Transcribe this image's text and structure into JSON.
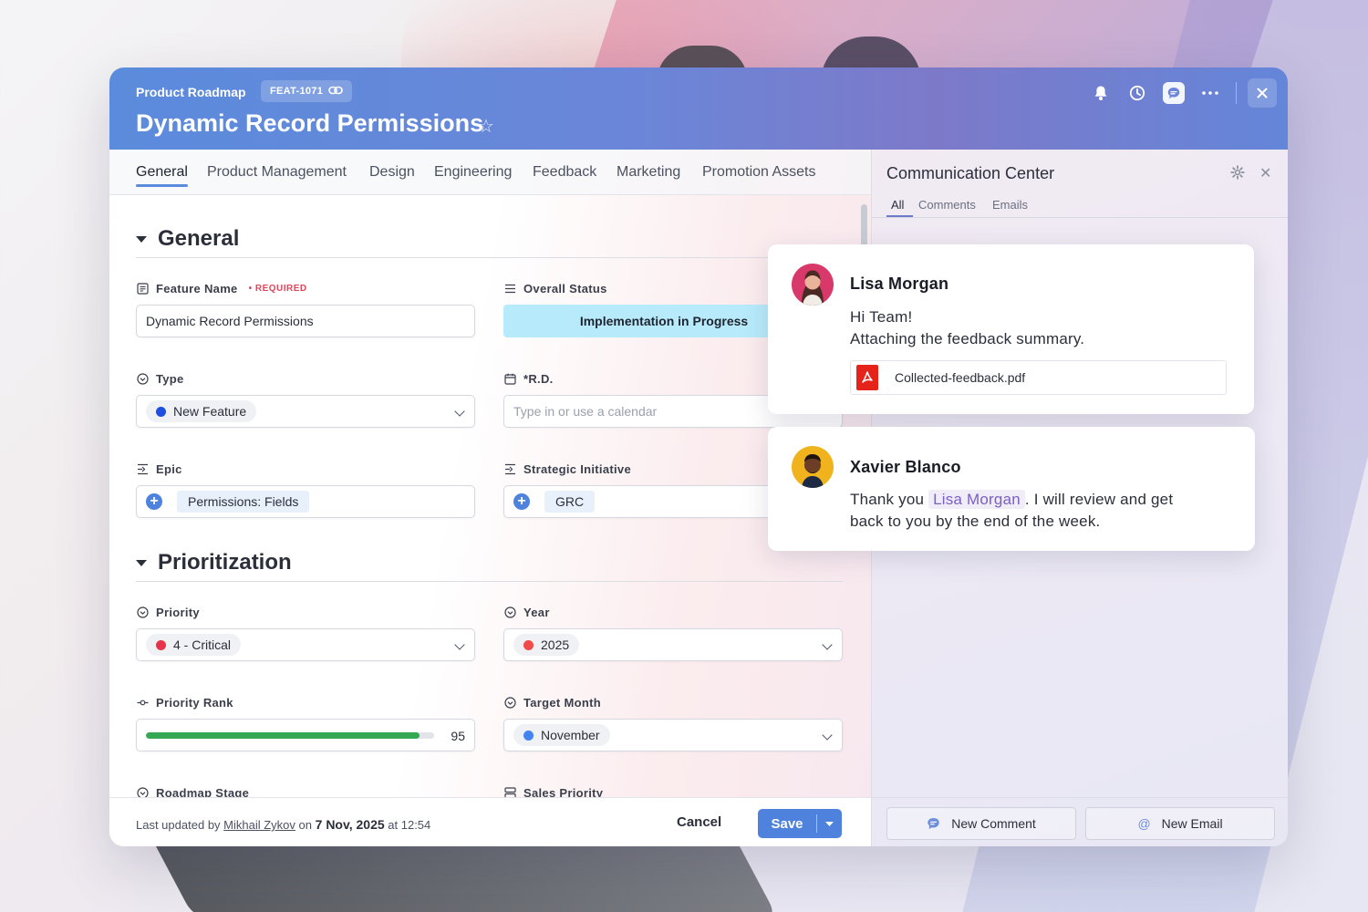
{
  "header": {
    "breadcrumb": "Product Roadmap",
    "key": "FEAT-1071",
    "title": "Dynamic Record Permissions"
  },
  "tabs": [
    "General",
    "Product Management",
    "Design",
    "Engineering",
    "Feedback",
    "Marketing",
    "Promotion Assets"
  ],
  "sections": {
    "general": "General",
    "prioritization": "Prioritization"
  },
  "fields": {
    "feature_name": {
      "label": "Feature Name",
      "required": "• REQUIRED",
      "value": "Dynamic Record Permissions"
    },
    "overall_status": {
      "label": "Overall Status",
      "value": "Implementation in Progress"
    },
    "type": {
      "label": "Type",
      "value": "New Feature",
      "color": "#1f4fe0"
    },
    "rd": {
      "label": "*R.D.",
      "placeholder": "Type in or use a calendar"
    },
    "epic": {
      "label": "Epic",
      "value": "Permissions: Fields"
    },
    "strategic_initiative": {
      "label": "Strategic Initiative",
      "value": "GRC"
    },
    "priority": {
      "label": "Priority",
      "value": "4 - Critical",
      "color": "#e8344a"
    },
    "year": {
      "label": "Year",
      "value": "2025",
      "color": "#f04a4a"
    },
    "priority_rank": {
      "label": "Priority Rank",
      "value": "95",
      "fraction": 0.95
    },
    "target_month": {
      "label": "Target Month",
      "value": "November",
      "color": "#4384f0"
    },
    "roadmap_stage": {
      "label": "Roadmap Stage"
    },
    "sales_priority": {
      "label": "Sales Priority"
    }
  },
  "footer": {
    "updated_prefix": "Last updated",
    "by": "by",
    "user": "Mikhail Zykov",
    "on": "on",
    "date": "7 Nov, 2025",
    "at": "at 12:54",
    "cancel": "Cancel",
    "save": "Save"
  },
  "comm": {
    "title": "Communication Center",
    "tabs": [
      "All",
      "Comments",
      "Emails"
    ],
    "new_comment": "New Comment",
    "new_email": "New Email",
    "messages": [
      {
        "author": "Lisa Morgan",
        "line1": "Hi Team!",
        "line2": "Attaching the feedback summary.",
        "attachment": "Collected-feedback.pdf"
      },
      {
        "author": "Xavier Blanco",
        "pre": "Thank you",
        "mention": "Lisa Morgan",
        "post": ". I will review and get",
        "line2": "back to you by the end of the week."
      }
    ]
  },
  "colors": {
    "accent": "#4e82dd",
    "progress": "#34a853",
    "status_bg": "#b7ebfb"
  }
}
